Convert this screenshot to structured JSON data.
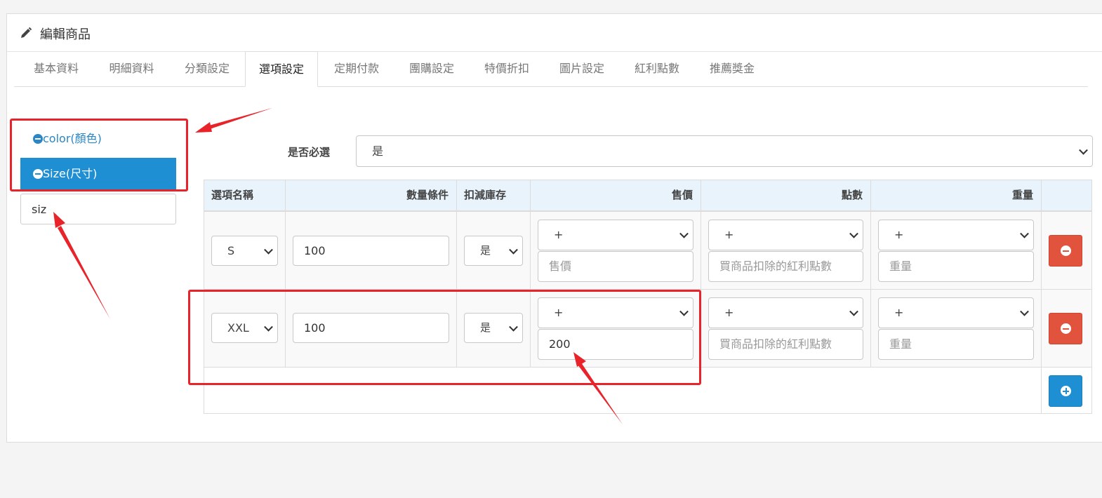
{
  "header": {
    "title": "編輯商品",
    "icon": "pencil-icon"
  },
  "tabs": [
    {
      "label": "基本資料",
      "active": false
    },
    {
      "label": "明細資料",
      "active": false
    },
    {
      "label": "分類設定",
      "active": false
    },
    {
      "label": "選項設定",
      "active": true
    },
    {
      "label": "定期付款",
      "active": false
    },
    {
      "label": "團購設定",
      "active": false
    },
    {
      "label": "特價折扣",
      "active": false
    },
    {
      "label": "圖片設定",
      "active": false
    },
    {
      "label": "紅利點數",
      "active": false
    },
    {
      "label": "推薦獎金",
      "active": false
    }
  ],
  "sidebar": {
    "items": [
      {
        "label": "color(顏色)",
        "selected": false,
        "icon": "minus-circle-icon"
      },
      {
        "label": "Size(尺寸)",
        "selected": true,
        "icon": "minus-circle-icon"
      }
    ],
    "new_option_input": "siz"
  },
  "required": {
    "label": "是否必選",
    "value": "是"
  },
  "table": {
    "headers": [
      "選項名稱",
      "數量條件",
      "扣減庫存",
      "售價",
      "點數",
      "重量"
    ],
    "rows": [
      {
        "name": "S",
        "quantity": "100",
        "deduct": "是",
        "price_sign": "+",
        "price": "",
        "price_placeholder": "售價",
        "points_sign": "+",
        "points": "",
        "points_placeholder": "買商品扣除的紅利點數",
        "weight_sign": "+",
        "weight": "",
        "weight_placeholder": "重量"
      },
      {
        "name": "XXL",
        "quantity": "100",
        "deduct": "是",
        "price_sign": "+",
        "price": "200",
        "price_placeholder": "售價",
        "points_sign": "+",
        "points": "",
        "points_placeholder": "買商品扣除的紅利點數",
        "weight_sign": "+",
        "weight": "",
        "weight_placeholder": "重量"
      }
    ]
  },
  "colors": {
    "primary": "#1f8fd3",
    "danger": "#e2533e",
    "header_bg": "#e8f3fc",
    "annotation": "#e8232a"
  }
}
